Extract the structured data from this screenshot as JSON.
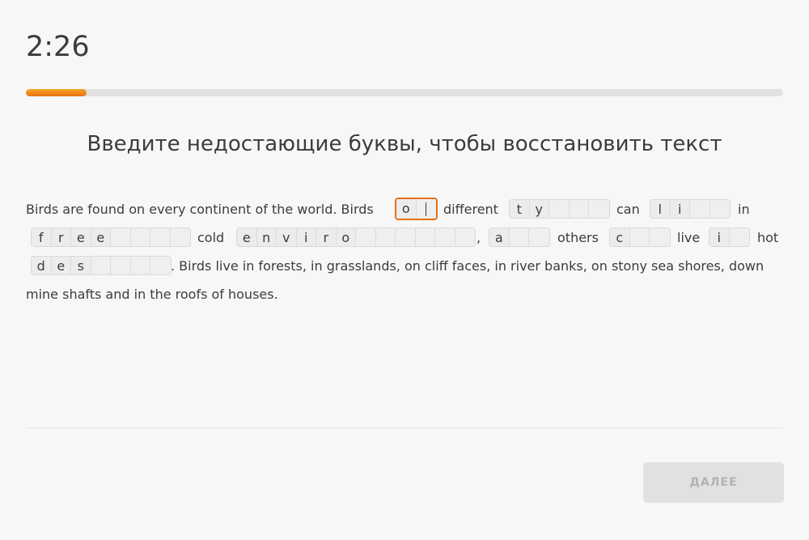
{
  "timer": "2:26",
  "progress": {
    "fraction": 0.08,
    "color": "#e8701a"
  },
  "title": "Введите недостающие буквы, чтобы восстановить текст",
  "passage": {
    "w1": "Birds are found on every continent of the world. Birds",
    "w2": "different",
    "w3": "can",
    "w4": "in",
    "w5": "cold",
    "w6": ",",
    "w7": "others",
    "w8": "live",
    "w9": "hot",
    "w10": ". Birds live in forests, in grasslands, on cliff faces, in river banks, on stony sea shores, down",
    "w11": "mine shafts and in the roofs of houses.",
    "blanks": [
      {
        "letters": [
          "o",
          ""
        ],
        "active": true
      },
      {
        "letters": [
          "t",
          "y",
          "",
          "",
          ""
        ]
      },
      {
        "letters": [
          "l",
          "i",
          "",
          ""
        ]
      },
      {
        "letters": [
          "f",
          "r",
          "e",
          "e",
          "",
          "",
          "",
          ""
        ]
      },
      {
        "letters": [
          "e",
          "n",
          "v",
          "i",
          "r",
          "o",
          "",
          "",
          "",
          "",
          "",
          ""
        ]
      },
      {
        "letters": [
          "a",
          "",
          ""
        ]
      },
      {
        "letters": [
          "c",
          "",
          ""
        ]
      },
      {
        "letters": [
          "i",
          ""
        ]
      },
      {
        "letters": [
          "d",
          "e",
          "s",
          "",
          "",
          "",
          ""
        ]
      }
    ]
  },
  "next_button": {
    "label": "ДАЛЕЕ",
    "disabled": true
  }
}
